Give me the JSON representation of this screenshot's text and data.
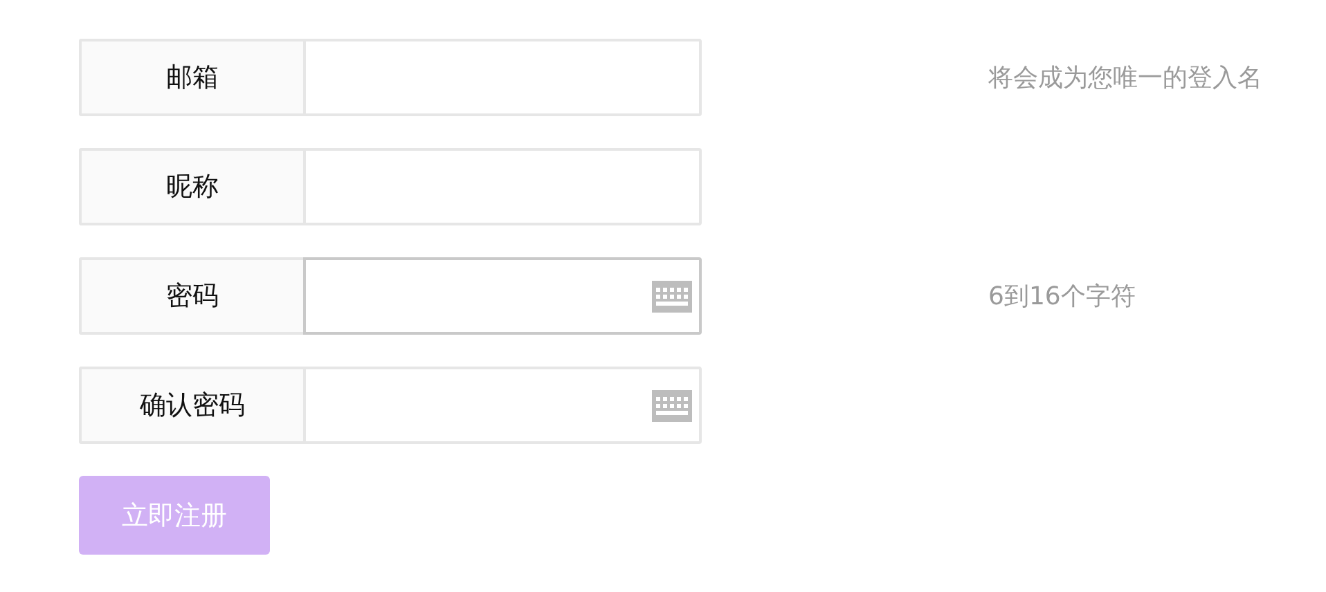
{
  "fields": [
    {
      "label": "邮箱",
      "kind": "text",
      "focused": false,
      "hint": "将会成为您唯一的登入名"
    },
    {
      "label": "昵称",
      "kind": "text",
      "focused": false
    },
    {
      "label": "密码",
      "kind": "password",
      "focused": true,
      "hint": "6到16个字符"
    },
    {
      "label": "确认密码",
      "kind": "password",
      "focused": false
    }
  ],
  "submit": {
    "label": "立即注册",
    "disabled": true
  }
}
